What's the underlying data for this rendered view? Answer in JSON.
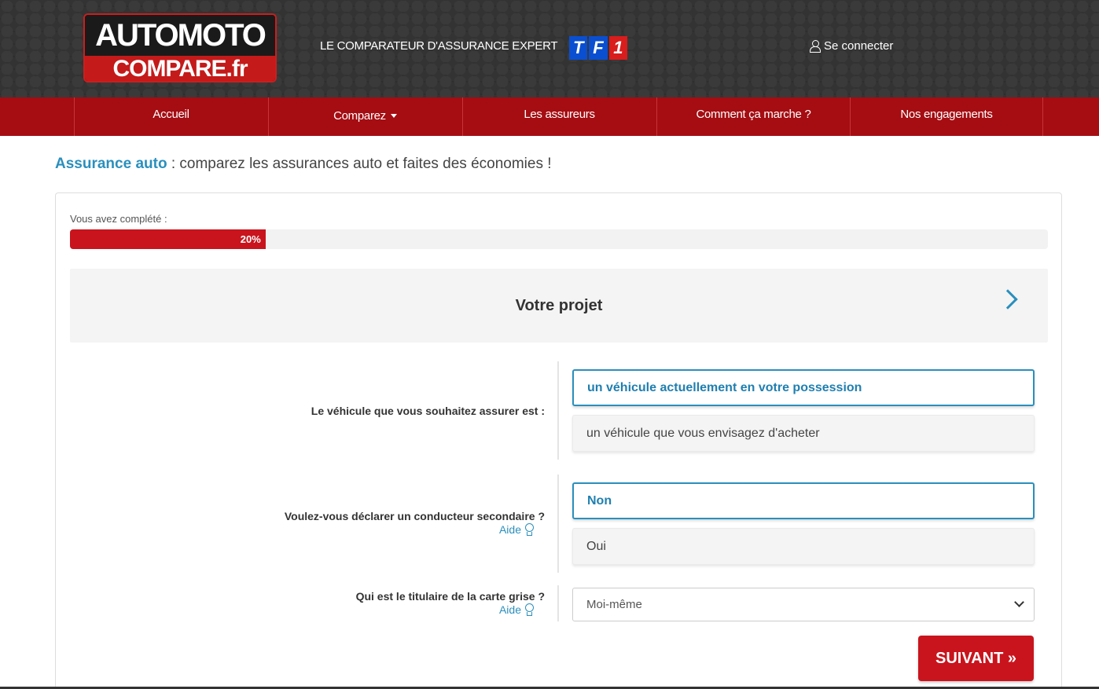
{
  "header": {
    "logo_top": "AUTOMOTO",
    "logo_bottom": "COMPARE.fr",
    "tagline": "LE COMPARATEUR D'ASSURANCE EXPERT",
    "partner_logo": [
      "T",
      "F",
      "1"
    ],
    "login_label": "Se connecter",
    "login_icon": "user-icon"
  },
  "nav": {
    "items": [
      {
        "label": "Accueil"
      },
      {
        "label": "Comparez",
        "icon": "caret-down-icon"
      },
      {
        "label": "Les assureurs"
      },
      {
        "label": "Comment ça marche ?"
      },
      {
        "label": "Nos engagements"
      }
    ]
  },
  "page": {
    "title_highlight": "Assurance auto",
    "title_rest": " : comparez les assurances auto et faites des économies !"
  },
  "progress": {
    "label": "Vous avez complété :",
    "value_text": "20%",
    "value": 0.2
  },
  "section": {
    "title": "Votre projet",
    "icon": "chevron-right-icon"
  },
  "questions": [
    {
      "label": "Le véhicule que vous souhaitez assurer est :",
      "options": [
        {
          "label": "un véhicule actuellement en votre possession",
          "selected": true
        },
        {
          "label": "un véhicule que vous envisagez d'acheter",
          "selected": false
        }
      ]
    },
    {
      "label": "Voulez-vous déclarer un conducteur secondaire ?",
      "help": "Aide",
      "options": [
        {
          "label": "Non",
          "selected": true
        },
        {
          "label": "Oui",
          "selected": false
        }
      ]
    },
    {
      "label": "Qui est le titulaire de la carte grise ?",
      "help": "Aide",
      "select_value": "Moi-même"
    }
  ],
  "buttons": {
    "next": "SUIVANT »"
  },
  "colors": {
    "brand_red": "#c9141d",
    "nav_red": "#a50d12",
    "accent_blue": "#2a8fbd",
    "header_dark": "#2a2a2a"
  }
}
